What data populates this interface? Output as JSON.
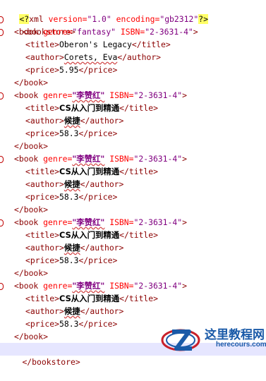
{
  "decl": {
    "open": "<?",
    "name": "xml",
    "version_attr": " version=",
    "version_val": "\"1.0\"",
    "enc_attr": " encoding=",
    "enc_val": "\"gb2312\"",
    "close": "?>"
  },
  "root": {
    "open": "<bookstore>",
    "close": "</bookstore>"
  },
  "books": [
    {
      "genre": "\"fantasy\"",
      "isbn": "\"2-3631-4\"",
      "title": "Oberon's Legacy",
      "author": "Corets, Eva",
      "price": "5.95"
    },
    {
      "genre": "\"李赞红\"",
      "isbn": "\"2-3631-4\"",
      "title": "CS从入门到精通",
      "author": "候捷",
      "price": "58.3"
    },
    {
      "genre": "\"李赞红\"",
      "isbn": "\"2-3631-4\"",
      "title": "CS从入门到精通",
      "author": "候捷",
      "price": "58.3"
    },
    {
      "genre": "\"李赞红\"",
      "isbn": "\"2-3631-4\"",
      "title": "CS从入门到精通",
      "author": "候捷",
      "price": "58.3"
    },
    {
      "genre": "\"李赞红\"",
      "isbn": "\"2-3631-4\"",
      "title": "CS从入门到精通",
      "author": "候捷",
      "price": "58.3"
    }
  ],
  "tags": {
    "book_open": "<book",
    "genre_attr": " genre=",
    "isbn_attr": " ISBN=",
    "gt": ">",
    "book_close": "</book>",
    "title_open": "<title>",
    "title_close": "</title>",
    "author_open": "<author>",
    "author_close": "</author>",
    "price_open": "<price>",
    "price_close": "</price>"
  },
  "watermark": {
    "name": "这里教程网",
    "url": "herecours.com"
  },
  "colors": {
    "tag": "#8b0000",
    "attr": "#ff0000",
    "value": "#800080",
    "bracket": "#0000ff",
    "current_line": "#e6e6ff"
  }
}
